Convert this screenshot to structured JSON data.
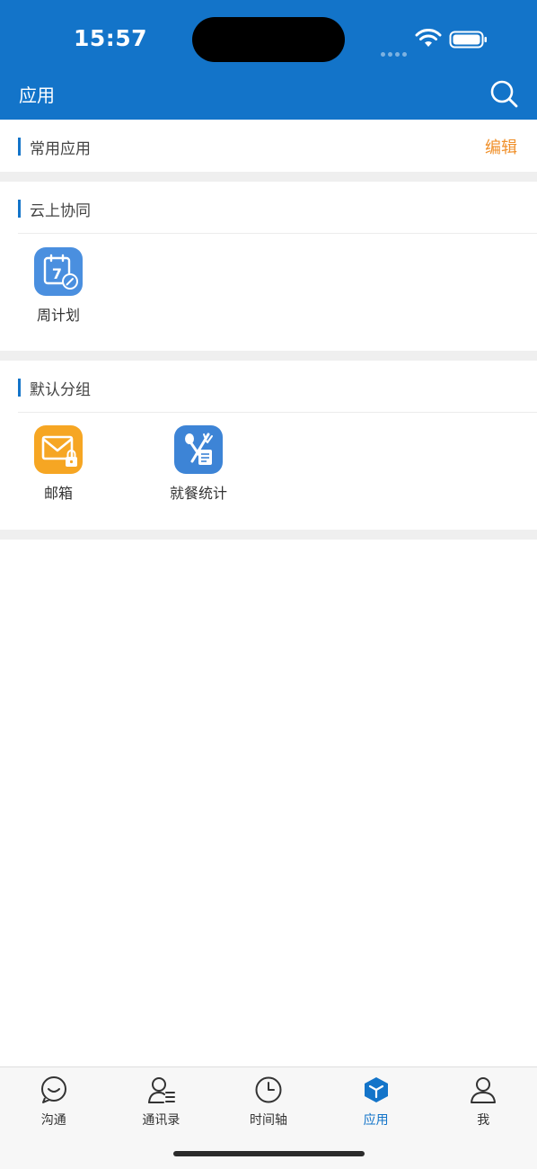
{
  "status_bar": {
    "time": "15:57"
  },
  "header": {
    "title": "应用",
    "search_icon": "search-icon"
  },
  "sections": {
    "favorites": {
      "title": "常用应用",
      "edit_label": "编辑"
    },
    "cloud": {
      "title": "云上协同",
      "apps": [
        {
          "label": "周计划",
          "icon": "weekly-plan-icon",
          "color": "#4a8fdf"
        }
      ]
    },
    "default_group": {
      "title": "默认分组",
      "apps": [
        {
          "label": "邮箱",
          "icon": "mailbox-icon",
          "color": "#f6a623"
        },
        {
          "label": "就餐统计",
          "icon": "dining-stats-icon",
          "color": "#3d84d6"
        }
      ]
    }
  },
  "tabbar": {
    "tabs": [
      {
        "label": "沟通",
        "icon": "chat-icon"
      },
      {
        "label": "通讯录",
        "icon": "contacts-icon"
      },
      {
        "label": "时间轴",
        "icon": "timeline-clock-icon"
      },
      {
        "label": "应用",
        "icon": "apps-cube-icon",
        "active": true
      },
      {
        "label": "我",
        "icon": "profile-icon"
      }
    ]
  },
  "colors": {
    "primary": "#1374c9",
    "accent": "#f0912c",
    "section_gap": "#efefef"
  }
}
